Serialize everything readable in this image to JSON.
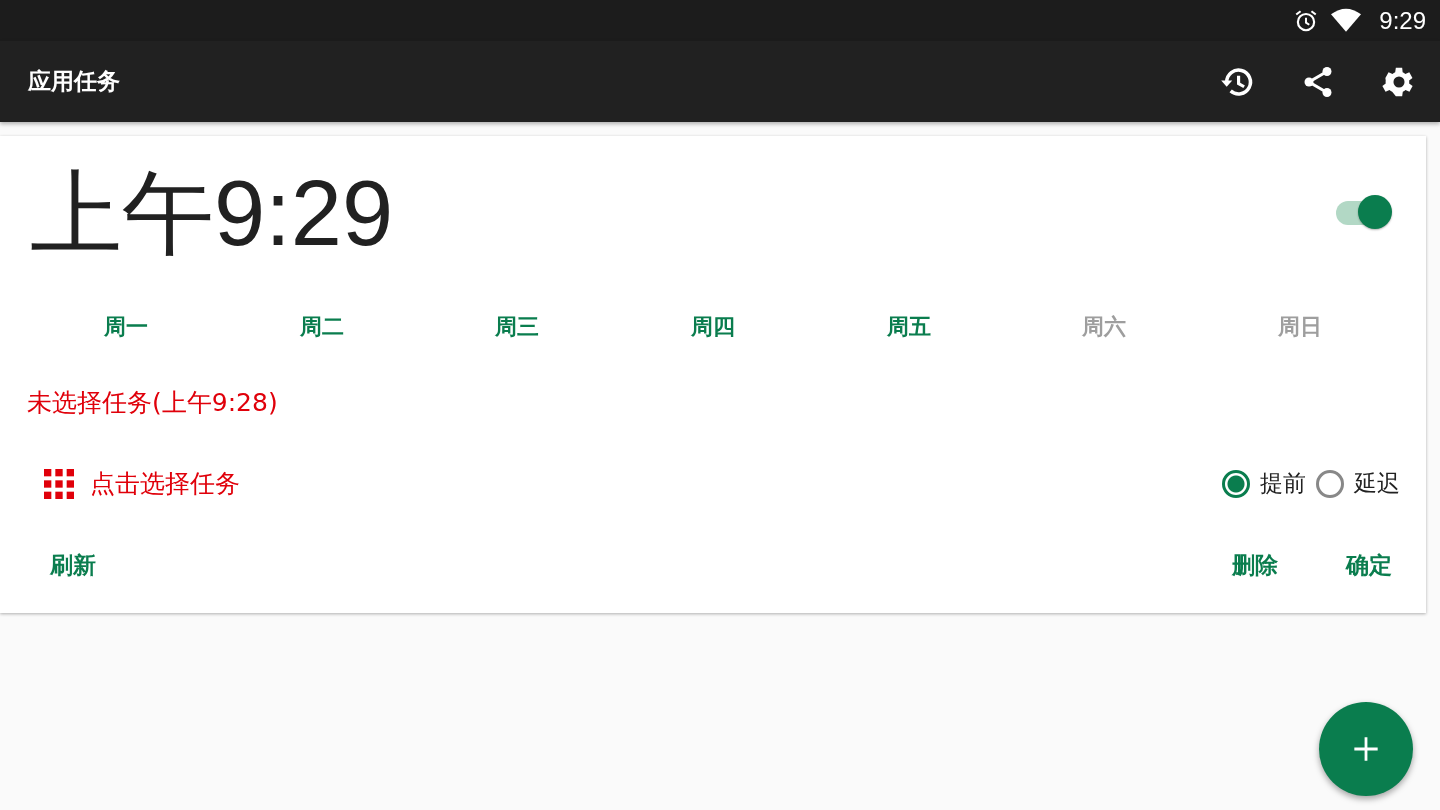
{
  "status_bar": {
    "time": "9:29"
  },
  "app_bar": {
    "title": "应用任务"
  },
  "alarm": {
    "time": "上午9:29",
    "enabled": true,
    "days": [
      {
        "label": "周一",
        "selected": true
      },
      {
        "label": "周二",
        "selected": true
      },
      {
        "label": "周三",
        "selected": true
      },
      {
        "label": "周四",
        "selected": true
      },
      {
        "label": "周五",
        "selected": true
      },
      {
        "label": "周六",
        "selected": false
      },
      {
        "label": "周日",
        "selected": false
      }
    ],
    "task_status": "未选择任务(上午9:28)",
    "choose_task": "点击选择任务",
    "timing": [
      {
        "label": "提前",
        "selected": true
      },
      {
        "label": "延迟",
        "selected": false
      }
    ],
    "actions_left": [
      "刷新"
    ],
    "actions_right": [
      "删除",
      "确定"
    ]
  }
}
